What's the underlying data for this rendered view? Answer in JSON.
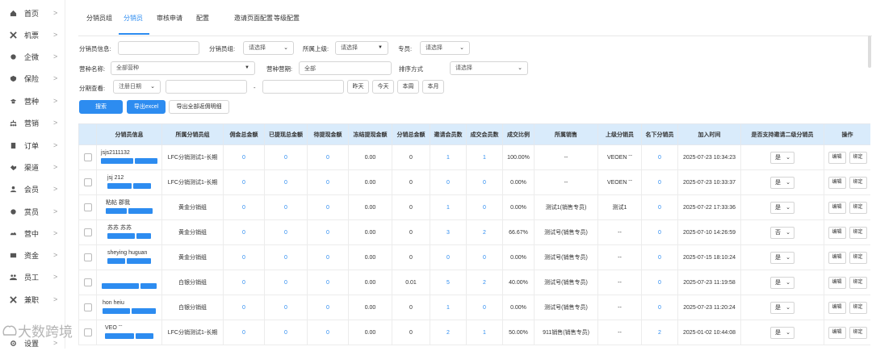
{
  "sidebar": {
    "items": [
      {
        "label": "首页",
        "icon": "home-icon"
      },
      {
        "label": "机票",
        "icon": "plane-icon"
      },
      {
        "label": "企微",
        "icon": "chat-icon"
      },
      {
        "label": "保险",
        "icon": "shield-icon"
      },
      {
        "label": "营种",
        "icon": "hat-icon"
      },
      {
        "label": "营销",
        "icon": "network-icon"
      },
      {
        "label": "订单",
        "icon": "order-icon"
      },
      {
        "label": "渠道",
        "icon": "handshake-icon"
      },
      {
        "label": "会员",
        "icon": "user-icon"
      },
      {
        "label": "赏员",
        "icon": "gift-icon"
      },
      {
        "label": "营中",
        "icon": "cloud-icon"
      },
      {
        "label": "资金",
        "icon": "money-icon"
      },
      {
        "label": "员工",
        "icon": "staff-icon"
      },
      {
        "label": "兼职",
        "icon": "tools-icon"
      },
      {
        "label": "设置",
        "icon": "gear-icon"
      }
    ]
  },
  "tabs": [
    {
      "label": "分销员组"
    },
    {
      "label": "分销员",
      "active": true
    },
    {
      "label": "审核申请"
    },
    {
      "label": "配置"
    },
    {
      "label": "邀请页面配置"
    },
    {
      "label": "等级配置"
    }
  ],
  "filters": {
    "info_label": "分销员信息:",
    "group_label": "分销员组:",
    "group_value": "请选择",
    "superior_label": "所属上级:",
    "superior_value": "请选择",
    "specialist_label": "专员:",
    "specialist_value": "请选择",
    "camp_name_label": "营种名称:",
    "camp_name_value": "全部营种",
    "camp_period_label": "营种营期:",
    "camp_period_value": "全部",
    "sort_label": "排序方式",
    "sort_value": "请选择",
    "period_label": "分期查看:",
    "period_value": "注册日期",
    "range_sep": "-",
    "yesterday": "昨天",
    "today": "今天",
    "this_week": "本周",
    "this_month": "本月"
  },
  "actions": {
    "search": "搜索",
    "export_excel": "导出excel",
    "export_all": "导出全部返佣明细"
  },
  "table": {
    "headers": [
      "分销员信息",
      "所属分销员组",
      "佣金总金额",
      "已提现总金额",
      "待提现金额",
      "冻结提现金额",
      "分销总金额",
      "邀请会员数",
      "成交会员数",
      "成交比例",
      "所属销售",
      "上级分销员",
      "名下分销员",
      "加入时间",
      "是否支持邀请二级分销员",
      "操作"
    ],
    "edit_label": "编辑",
    "unbind_label": "绑定",
    "rows": [
      {
        "info1": "jsjs2111132",
        "info2": "",
        "group": "LFC分销测试1-长期",
        "commission": "0",
        "withdrawn": "0",
        "pending": "0",
        "frozen": "0.00",
        "dist_total": "0",
        "invited": "1",
        "deal": "1",
        "ratio": "100.00%",
        "sales": "--",
        "superior": "VEOEN ˉˉ",
        "subordinates": "0",
        "join_time": "2025-07-23 10:34:23",
        "support": "是"
      },
      {
        "info1": "jsj  212",
        "info2": "",
        "group": "LFC分销测试1-长期",
        "commission": "0",
        "withdrawn": "0",
        "pending": "0",
        "frozen": "0.00",
        "dist_total": "0",
        "invited": "0",
        "deal": "0",
        "ratio": "0.00%",
        "sales": "--",
        "superior": "VEOEN ˉˉ",
        "subordinates": "0",
        "join_time": "2025-07-23 10:33:37",
        "support": "是"
      },
      {
        "info1": "粘帖   郡我",
        "info2": "",
        "group": "黄金分销组",
        "commission": "0",
        "withdrawn": "0",
        "pending": "0",
        "frozen": "0.00",
        "dist_total": "0",
        "invited": "1",
        "deal": "0",
        "ratio": "0.00%",
        "sales": "测试1(销售专员)",
        "superior": "测试1",
        "subordinates": "0",
        "join_time": "2025-07-22 17:33:36",
        "support": "是"
      },
      {
        "info1": "苏苏    苏苏",
        "info2": "",
        "group": "黄金分销组",
        "commission": "0",
        "withdrawn": "0",
        "pending": "0",
        "frozen": "0.00",
        "dist_total": "0",
        "invited": "3",
        "deal": "2",
        "ratio": "66.67%",
        "sales": "测试号(销售专员)",
        "superior": "--",
        "subordinates": "0",
        "join_time": "2025-07-10 14:26:59",
        "support": "否"
      },
      {
        "info1": "sheying    huguan",
        "info2": "",
        "group": "黄金分销组",
        "commission": "0",
        "withdrawn": "0",
        "pending": "0",
        "frozen": "0.00",
        "dist_total": "0",
        "invited": "0",
        "deal": "0",
        "ratio": "0.00%",
        "sales": "测试号(销售专员)",
        "superior": "--",
        "subordinates": "0",
        "join_time": "2025-07-15 18:10:24",
        "support": "是"
      },
      {
        "info1": "",
        "info2": "",
        "group": "白银分销组",
        "commission": "0",
        "withdrawn": "0",
        "pending": "0",
        "frozen": "0.00",
        "dist_total": "0.01",
        "invited": "5",
        "deal": "2",
        "ratio": "40.00%",
        "sales": "测试号(销售专员)",
        "superior": "--",
        "subordinates": "0",
        "join_time": "2025-07-23 11:19:58",
        "support": "是"
      },
      {
        "info1": "hon   heiu",
        "info2": "",
        "group": "白银分销组",
        "commission": "0",
        "withdrawn": "0",
        "pending": "0",
        "frozen": "0.00",
        "dist_total": "0",
        "invited": "1",
        "deal": "0",
        "ratio": "0.00%",
        "sales": "测试号(销售专员)",
        "superior": "--",
        "subordinates": "0",
        "join_time": "2025-07-23 11:20:24",
        "support": "是"
      },
      {
        "info1": "VEO   ˉˉ",
        "info2": "",
        "group": "LFC分销测试1-长期",
        "commission": "0",
        "withdrawn": "0",
        "pending": "0",
        "frozen": "0.00",
        "dist_total": "0",
        "invited": "2",
        "deal": "1",
        "ratio": "50.00%",
        "sales": "911销售(销售专员)",
        "superior": "--",
        "subordinates": "2",
        "join_time": "2025-01-02 10:44:08",
        "support": "是"
      }
    ]
  },
  "watermark": "大数跨境",
  "colors": {
    "accent": "#2d8cf0",
    "header_bg": "#d9ebfb"
  }
}
